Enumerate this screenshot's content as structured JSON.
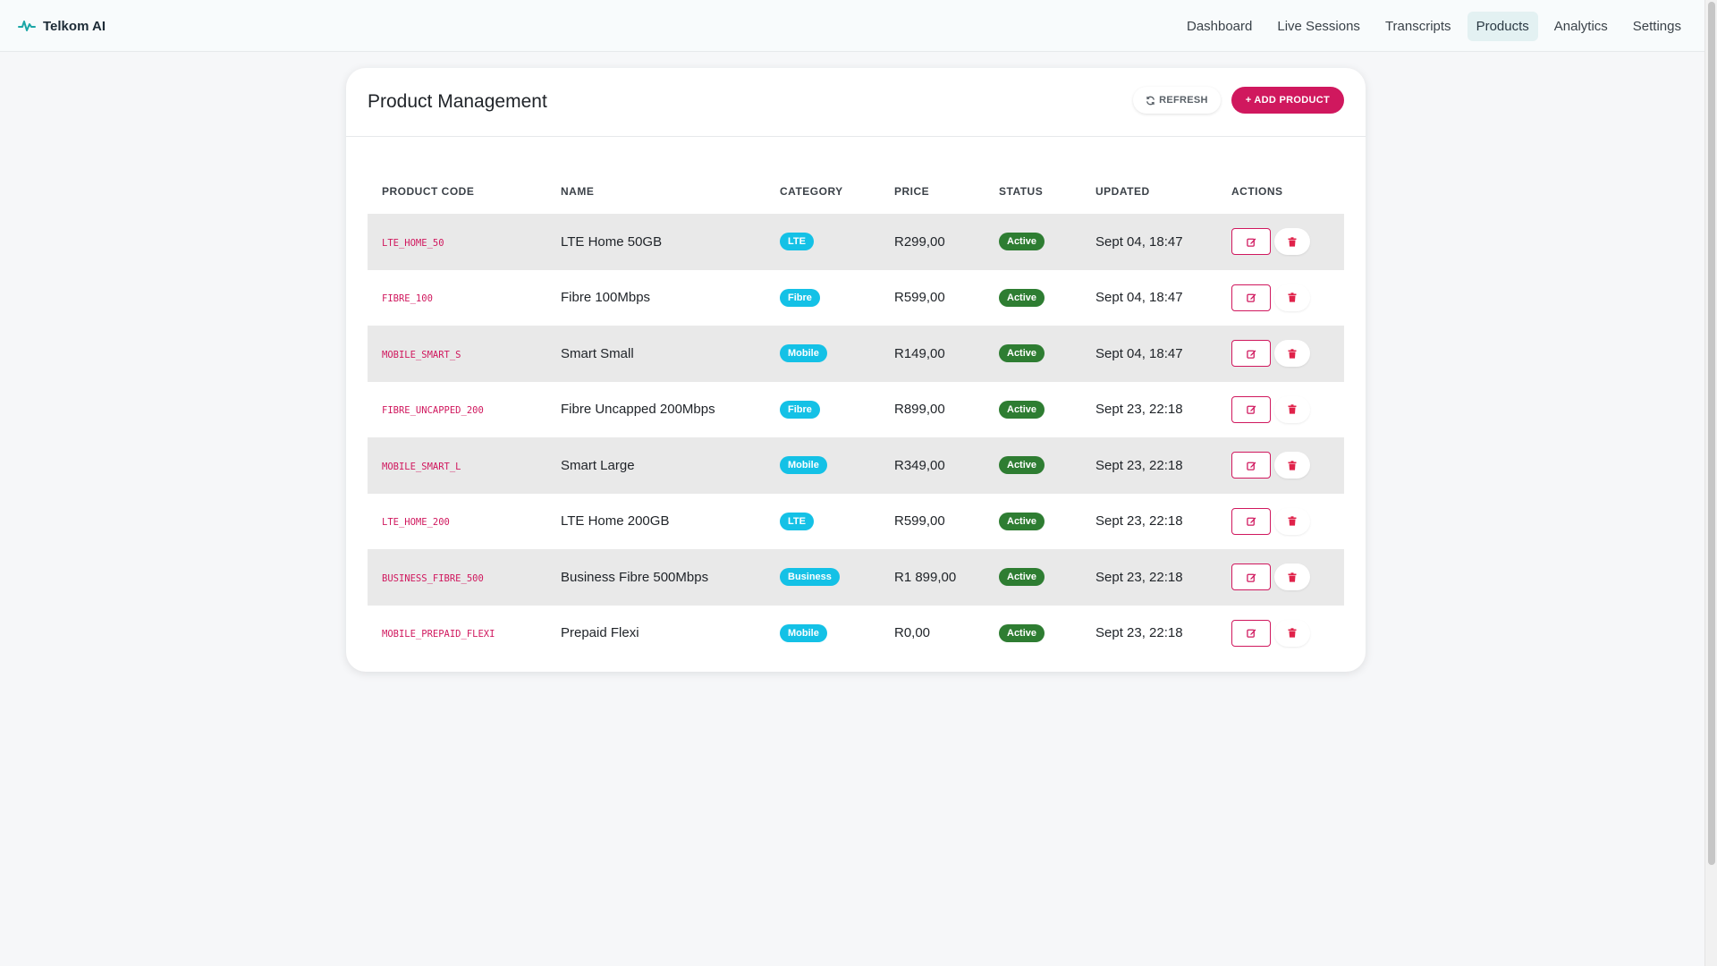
{
  "app": {
    "brand": "Telkom AI"
  },
  "nav": {
    "items": [
      {
        "label": "Dashboard",
        "active": false
      },
      {
        "label": "Live Sessions",
        "active": false
      },
      {
        "label": "Transcripts",
        "active": false
      },
      {
        "label": "Products",
        "active": true
      },
      {
        "label": "Analytics",
        "active": false
      },
      {
        "label": "Settings",
        "active": false
      }
    ]
  },
  "page": {
    "title": "Product Management",
    "refresh_label": "REFRESH",
    "add_label": "+ ADD PRODUCT"
  },
  "table": {
    "headers": [
      "PRODUCT CODE",
      "NAME",
      "CATEGORY",
      "PRICE",
      "STATUS",
      "UPDATED",
      "ACTIONS"
    ],
    "rows": [
      {
        "code": "LTE_HOME_50",
        "name": "LTE Home 50GB",
        "category": "LTE",
        "price": "R299,00",
        "status": "Active",
        "updated": "Sept 04, 18:47"
      },
      {
        "code": "FIBRE_100",
        "name": "Fibre 100Mbps",
        "category": "Fibre",
        "price": "R599,00",
        "status": "Active",
        "updated": "Sept 04, 18:47"
      },
      {
        "code": "MOBILE_SMART_S",
        "name": "Smart Small",
        "category": "Mobile",
        "price": "R149,00",
        "status": "Active",
        "updated": "Sept 04, 18:47"
      },
      {
        "code": "FIBRE_UNCAPPED_200",
        "name": "Fibre Uncapped 200Mbps",
        "category": "Fibre",
        "price": "R899,00",
        "status": "Active",
        "updated": "Sept 23, 22:18"
      },
      {
        "code": "MOBILE_SMART_L",
        "name": "Smart Large",
        "category": "Mobile",
        "price": "R349,00",
        "status": "Active",
        "updated": "Sept 23, 22:18"
      },
      {
        "code": "LTE_HOME_200",
        "name": "LTE Home 200GB",
        "category": "LTE",
        "price": "R599,00",
        "status": "Active",
        "updated": "Sept 23, 22:18"
      },
      {
        "code": "BUSINESS_FIBRE_500",
        "name": "Business Fibre 500Mbps",
        "category": "Business",
        "price": "R1 899,00",
        "status": "Active",
        "updated": "Sept 23, 22:18"
      },
      {
        "code": "MOBILE_PREPAID_FLEXI",
        "name": "Prepaid Flexi",
        "category": "Mobile",
        "price": "R0,00",
        "status": "Active",
        "updated": "Sept 23, 22:18"
      }
    ]
  },
  "colors": {
    "accent": "#d0185e",
    "category_badge": "#14c1e6",
    "status_active": "#2e7d32",
    "brand_icon": "#1ba6a6"
  },
  "icons": {
    "brand": "pulse-icon",
    "refresh": "refresh-icon",
    "edit": "edit-icon",
    "delete": "trash-icon"
  }
}
